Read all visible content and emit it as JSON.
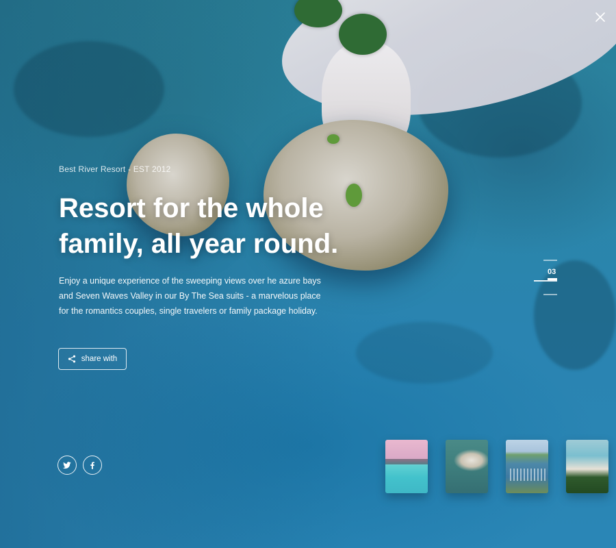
{
  "hero": {
    "eyebrow": "Best River Resort - EST 2012",
    "headline_lines": [
      "Resort for the whole",
      "family, all year round."
    ],
    "description_lines": [
      "Enjoy a unique experience of the sweeping views over he azure bays",
      "and Seven Waves Valley in our By The Sea suits - a marvelous place",
      "for the romantics couples, single travelers or family package holiday."
    ],
    "share_label": "share with"
  },
  "slider": {
    "current": "03"
  },
  "social": {
    "items": [
      {
        "icon": "twitter-icon"
      },
      {
        "icon": "facebook-icon"
      }
    ]
  },
  "thumbnails": [
    {
      "name": "infinity-pool-thumbnail"
    },
    {
      "name": "island-aerial-thumbnail"
    },
    {
      "name": "marina-thumbnail"
    },
    {
      "name": "beach-palms-thumbnail"
    }
  ],
  "icons": {
    "close": "close-icon",
    "share": "share-icon"
  }
}
